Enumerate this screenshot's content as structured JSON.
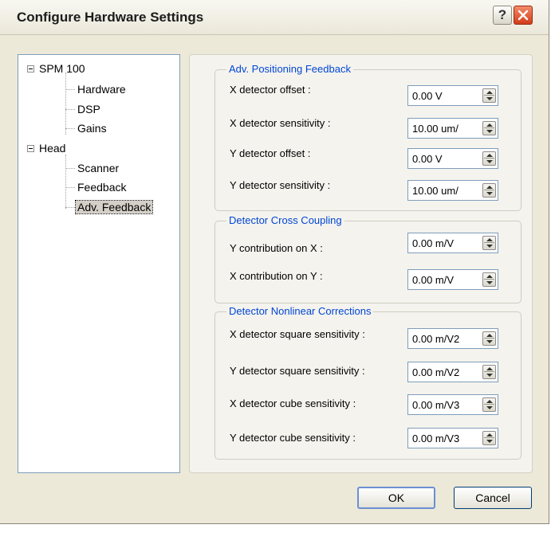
{
  "window": {
    "title": "Configure Hardware Settings",
    "help_glyph": "?",
    "icons": {
      "help": "help-icon",
      "close": "close-icon"
    }
  },
  "tree": {
    "items": [
      {
        "label": "SPM 100",
        "expanded": true
      },
      {
        "label": "Hardware"
      },
      {
        "label": "DSP"
      },
      {
        "label": "Gains"
      },
      {
        "label": "Head",
        "expanded": true
      },
      {
        "label": "Scanner"
      },
      {
        "label": "Feedback"
      },
      {
        "label": "Adv. Feedback",
        "selected": true
      }
    ]
  },
  "groups": {
    "positioning": {
      "title": "Adv. Positioning Feedback",
      "fields": [
        {
          "label": "X detector offset :",
          "value": "0.00 V"
        },
        {
          "label": "X detector sensitivity :",
          "value": "10.00 um/"
        },
        {
          "label": "Y detector offset :",
          "value": "0.00 V"
        },
        {
          "label": "Y detector sensitivity :",
          "value": "10.00 um/"
        }
      ]
    },
    "cross": {
      "title": "Detector Cross Coupling",
      "fields": [
        {
          "label": "Y contribution on X :",
          "value": "0.00 m/V"
        },
        {
          "label": "X contribution on Y :",
          "value": "0.00 m/V"
        }
      ]
    },
    "nonlinear": {
      "title": "Detector Nonlinear Corrections",
      "fields": [
        {
          "label": "X detector square sensitivity :",
          "value": "0.00 m/V2"
        },
        {
          "label": "Y detector square sensitivity :",
          "value": "0.00 m/V2"
        },
        {
          "label": "X detector cube sensitivity :",
          "value": "0.00 m/V3"
        },
        {
          "label": "Y detector cube sensitivity :",
          "value": "0.00 m/V3"
        }
      ]
    }
  },
  "buttons": {
    "ok": "OK",
    "cancel": "Cancel"
  },
  "colors": {
    "legend": "#0046d5",
    "close_button": "#d13d1a",
    "selection": "#d4d0c8"
  }
}
